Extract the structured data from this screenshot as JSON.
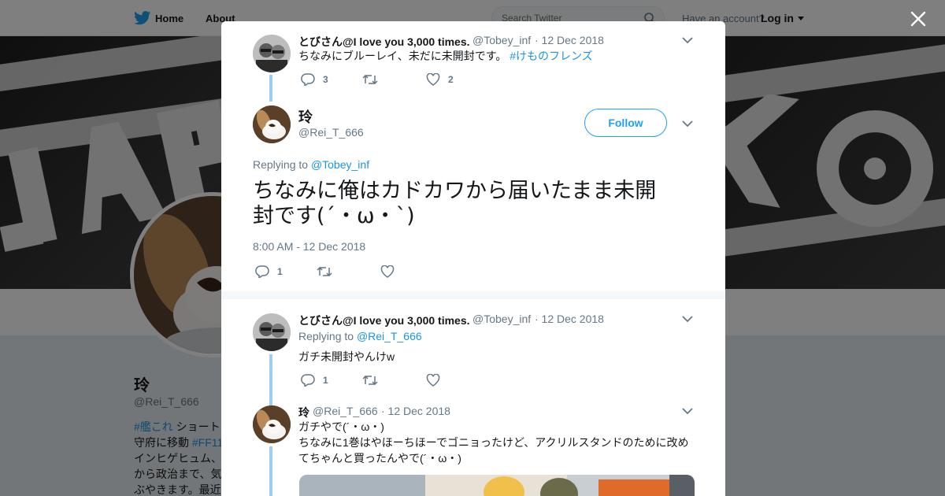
{
  "topbar": {
    "home_label": "Home",
    "about_label": "About",
    "search_placeholder": "Search Twitter",
    "have_account": "Have an account?",
    "login_label": "Log in"
  },
  "profile": {
    "name": "玲",
    "handle": "@Rei_T_666",
    "bio_lines": [
      {
        "pre": "",
        "tag": "#艦これ",
        "post": " ショート"
      },
      {
        "pre": "守府に移動 ",
        "tag": "#FF11",
        "post": ""
      },
      {
        "pre": "インヒゲヒュム、",
        "tag": "",
        "post": ""
      },
      {
        "pre": "から政治まで、気",
        "tag": "",
        "post": ""
      },
      {
        "pre": "ぶやきます。最近",
        "tag": "",
        "post": ""
      }
    ]
  },
  "modal": {
    "close_label": "×",
    "tweets": {
      "t1": {
        "name": "とびさん@I love you 3,000 times.",
        "handle": "@Tobey_inf",
        "date": "· 12 Dec 2018",
        "text_pre": "ちなみにブルーレイ、未だに未開封です。",
        "hashtag": "#けものフレンズ",
        "replies": "3",
        "retweets": "",
        "likes": "2"
      },
      "main": {
        "name": "玲",
        "handle": "@Rei_T_666",
        "follow_label": "Follow",
        "replying_to_label": "Replying to",
        "replying_to_handle": "@Tobey_inf",
        "text_line1": "ちなみに俺はカドカワから届いたまま未開",
        "text_line2": "封です(´・ω・`)",
        "timestamp": "8:00 AM - 12 Dec 2018",
        "replies": "1",
        "retweets": "",
        "likes": ""
      },
      "t3": {
        "name": "とびさん@I love you 3,000 times.",
        "handle": "@Tobey_inf",
        "date": "· 12 Dec 2018",
        "replying_to_label": "Replying to",
        "replying_to_handle": "@Rei_T_666",
        "text": "ガチ未開封やんけw",
        "replies": "1",
        "retweets": "",
        "likes": ""
      },
      "t4": {
        "name": "玲",
        "handle": "@Rei_T_666",
        "date": "· 12 Dec 2018",
        "text_line1": "ガチやで(´・ω・)",
        "text_line2": "ちなみに1巻はやほーちほーでゴニョったけど、アクリルスタンドのために改め",
        "text_line3": "てちゃんと買ったんやで(´・ω・)"
      }
    }
  },
  "icons": [
    "twitter-bird-icon",
    "search-icon",
    "caret-down-icon",
    "close-icon",
    "chevron-down-icon",
    "reply-icon",
    "retweet-icon",
    "like-icon"
  ],
  "colors": {
    "accent": "#1da1f2",
    "link": "#1b95e0",
    "muted": "#657786",
    "thread_line": "#9ecff2"
  }
}
